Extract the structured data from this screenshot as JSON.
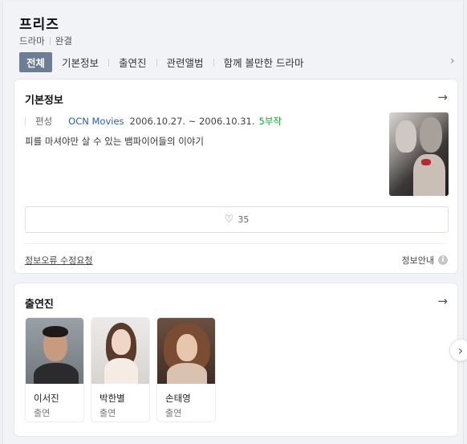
{
  "header": {
    "title": "프리즈",
    "genre": "드라마",
    "status": "완결"
  },
  "tabs": [
    {
      "label": "전체",
      "active": true
    },
    {
      "label": "기본정보",
      "active": false
    },
    {
      "label": "출연진",
      "active": false
    },
    {
      "label": "관련앨범",
      "active": false
    },
    {
      "label": "함께 볼만한 드라마",
      "active": false
    }
  ],
  "basic_info": {
    "title": "기본정보",
    "broadcast_label": "편성",
    "channel": "OCN Movies",
    "dates": "2006.10.27. ~ 2006.10.31.",
    "episodes": "5부작",
    "description": "피를 마셔야만 살 수 있는 뱀파이어들의 이야기",
    "like_count": "35",
    "report_link": "정보오류 수정요청",
    "info_guide": "정보안내",
    "info_guide_icon": "i"
  },
  "cast": {
    "title": "출연진",
    "members": [
      {
        "name": "이서진",
        "role": "출연"
      },
      {
        "name": "박한별",
        "role": "출연"
      },
      {
        "name": "손태영",
        "role": "출연"
      }
    ]
  },
  "icons": {
    "arrow_right": "→",
    "chevron_right": "›",
    "heart": "♡"
  },
  "colors": {
    "active_tab_bg": "#6c7d95",
    "link_blue": "#2a5fb6",
    "episode_green": "#17a633",
    "heart_red": "#e0414e"
  }
}
